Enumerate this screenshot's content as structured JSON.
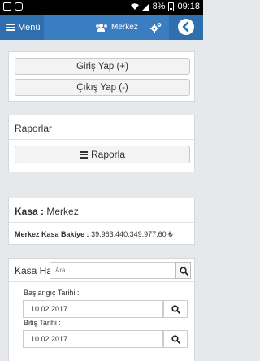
{
  "status_bar": {
    "battery": "8%",
    "time": "09:18"
  },
  "header": {
    "menu_label": "Menü",
    "title": "Merkez"
  },
  "login_panel": {
    "login_label": "Giriş Yap (+)",
    "logout_label": "Çıkış Yap (-)"
  },
  "reports_panel": {
    "title": "Raporlar",
    "report_button": "Raporla"
  },
  "cash_panel": {
    "title_label": "Kasa :",
    "title_value": "Merkez",
    "balance_label": "Merkez Kasa Bakiye :",
    "balance_value": "39.963.440.349.977,60 ₺"
  },
  "movements_panel": {
    "title": "Kasa Hareketleri",
    "search_placeholder": "Ara...",
    "start_label": "Başlangıç Tarihi :",
    "start_value": "10.02.2017",
    "end_label": "Bitiş Tarihi :",
    "end_value": "10.02.2017"
  }
}
